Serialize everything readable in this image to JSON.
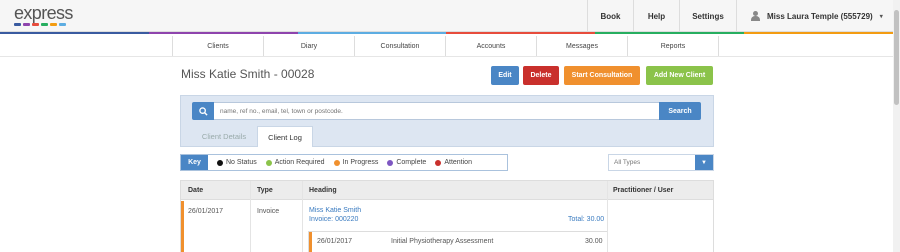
{
  "brand": {
    "name": "express",
    "bar_colors": [
      "#3a5ba0",
      "#8e44ad",
      "#e74c3c",
      "#27ae60",
      "#f39c12",
      "#5dade2"
    ]
  },
  "topnav": {
    "book": "Book",
    "help": "Help",
    "settings": "Settings",
    "user": "Miss Laura Temple (555729)",
    "user_caret": "▾"
  },
  "color_strip": [
    "#3a5ba0",
    "#8e44ad",
    "#5dade2",
    "#e74c3c",
    "#27ae60",
    "#f39c12"
  ],
  "subnav": [
    "Clients",
    "Diary",
    "Consultation",
    "Accounts",
    "Messages",
    "Reports"
  ],
  "page": {
    "title": "Miss Katie Smith - 00028"
  },
  "actions": {
    "edit": "Edit",
    "delete": "Delete",
    "start_consultation": "Start Consultation",
    "add_new_client": "Add New Client"
  },
  "search": {
    "placeholder": "name, ref no., email, tel, town or postcode.",
    "button": "Search"
  },
  "tabs": {
    "client_details": "Client Details",
    "client_log": "Client Log"
  },
  "key": {
    "label": "Key",
    "items": [
      {
        "label": "No Status",
        "color": "#111111"
      },
      {
        "label": "Action Required",
        "color": "#8bc34a"
      },
      {
        "label": "In Progress",
        "color": "#f0902e"
      },
      {
        "label": "Complete",
        "color": "#7e57c2"
      },
      {
        "label": "Attention",
        "color": "#c9302c"
      }
    ]
  },
  "filter": {
    "selected": "All Types"
  },
  "table": {
    "headers": [
      "Date",
      "Type",
      "Heading",
      "Practitioner / User"
    ],
    "rows": [
      {
        "date": "26/01/2017",
        "type": "Invoice",
        "heading_name": "Miss Katie Smith",
        "heading_invoice": "Invoice: 000220",
        "total": "Total: 30.00",
        "accent": "#f0902e",
        "subitems": [
          {
            "date": "26/01/2017",
            "description": "Initial Physiotherapy Assessment",
            "amount": "30.00"
          }
        ]
      }
    ]
  }
}
